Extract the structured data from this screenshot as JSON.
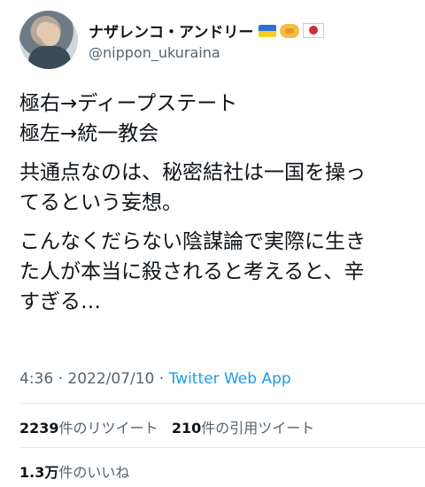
{
  "author": {
    "name": "ナザレンコ・アンドリー",
    "handle": "@nippon_ukuraina",
    "name_icons": [
      "ukraine-flag-icon",
      "handshake-icon",
      "japan-flag-icon"
    ]
  },
  "tweet": {
    "lines": [
      "極右→ディープステート",
      "極左→統一教会",
      "共通点なのは、秘密結社は一国を操っ",
      "てるという妄想。",
      "こんなくだらない陰謀論で実際に生き",
      "た人が本当に殺されると考えると、辛",
      "すぎる…"
    ],
    "time": "4:36 · 2022/07/10 · ",
    "app": "Twitter Web App"
  },
  "stats": {
    "retweets_count": "2239",
    "retweets_label": "件のリツイート",
    "quotes_count": "210",
    "quotes_label": "件の引用ツイート",
    "likes_count": "1.3万",
    "likes_label": "件のいいね"
  },
  "colors": {
    "link": "#1d9bf0",
    "secondary": "#536471",
    "text": "#0f1419"
  }
}
